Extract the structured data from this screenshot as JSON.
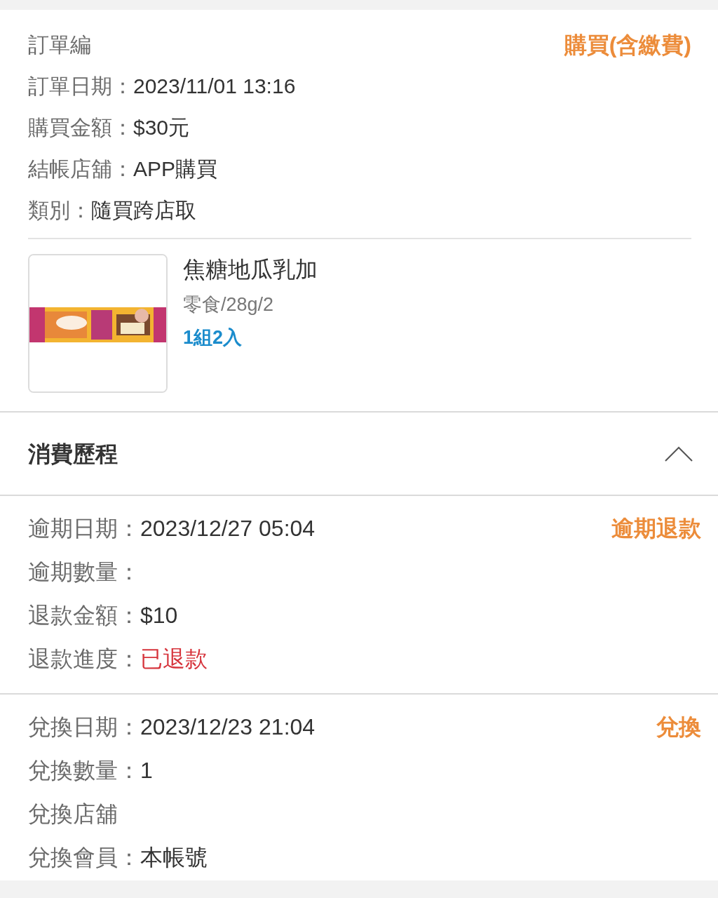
{
  "order": {
    "status_label": "購買(含繳費)",
    "fields": [
      {
        "label": "訂單編",
        "kind": "text"
      },
      {
        "label": "訂單日期：",
        "value": "2023/11/01 13:16",
        "kind": "text"
      },
      {
        "label": "購買金額：",
        "value": "$30元",
        "kind": "text"
      },
      {
        "label": "結帳店舖：",
        "value": "APP購買",
        "kind": "text"
      },
      {
        "label": "類別：",
        "value": "隨買跨店取",
        "kind": "text"
      }
    ]
  },
  "product": {
    "name": "焦糖地瓜乳加",
    "spec": "零食/28g/2",
    "pack": "1組2入"
  },
  "history": {
    "title": "消費歷程",
    "expanded": true,
    "entries": [
      {
        "type_label": "逾期退款",
        "fields": [
          {
            "label": "逾期日期：",
            "value": "2023/12/27 05:04",
            "kind": "text"
          },
          {
            "label": "逾期數量：",
            "kind": "text"
          },
          {
            "label": "退款金額：",
            "value": "$10",
            "kind": "text"
          },
          {
            "label": "退款進度：",
            "value": "已退款",
            "kind": "status"
          }
        ]
      },
      {
        "type_label": "兌換",
        "fields": [
          {
            "label": "兌換日期：",
            "value": "2023/12/23 21:04",
            "kind": "text"
          },
          {
            "label": "兌換數量：",
            "value": "1",
            "kind": "text"
          },
          {
            "label": "兌換店舖",
            "kind": "text"
          },
          {
            "label": "兌換會員：",
            "value": "本帳號",
            "kind": "text"
          }
        ]
      }
    ]
  }
}
